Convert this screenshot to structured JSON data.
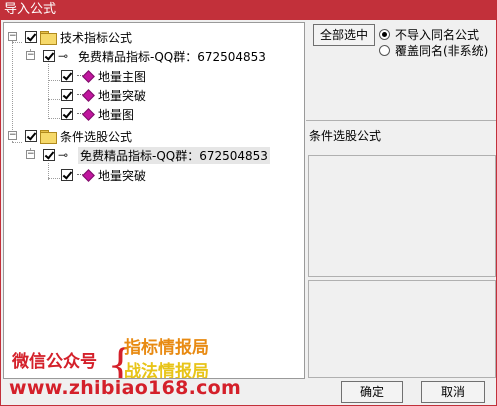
{
  "window": {
    "title": "导入公式"
  },
  "tree": {
    "group1": {
      "label": "技术指标公式",
      "subgroup": {
        "label": "免费精品指标-QQ群：672504853",
        "items": [
          "地量主图",
          "地量突破",
          "地量图"
        ]
      }
    },
    "group2": {
      "label": "条件选股公式",
      "subgroup": {
        "label": "免费精品指标-QQ群：672504853",
        "items": [
          "地量突破"
        ]
      }
    }
  },
  "watermark": {
    "wechat_label": "微信公众号",
    "brace": "{",
    "brand1": "指标情报局",
    "brand2": "战法情报局",
    "url": "www.zhibiao168.com"
  },
  "controls": {
    "select_all_label": "全部选中",
    "radio_options": [
      {
        "label": "不导入同名公式",
        "selected": true
      },
      {
        "label": "覆盖同名(非系统)",
        "selected": false
      }
    ],
    "description_label": "条件选股公式",
    "ok_label": "确定",
    "cancel_label": "取消"
  },
  "colors": {
    "titlebar": "#c2303a",
    "watermark_red": "#d4202a",
    "brand_orange": "#e88a12",
    "brand_yellow": "#e8c418",
    "formula_icon": "#c0169e"
  },
  "icons": {
    "toggle": "minus-box-icon",
    "folder": "folder-icon",
    "key": "key-icon",
    "formula": "formula-icon"
  }
}
